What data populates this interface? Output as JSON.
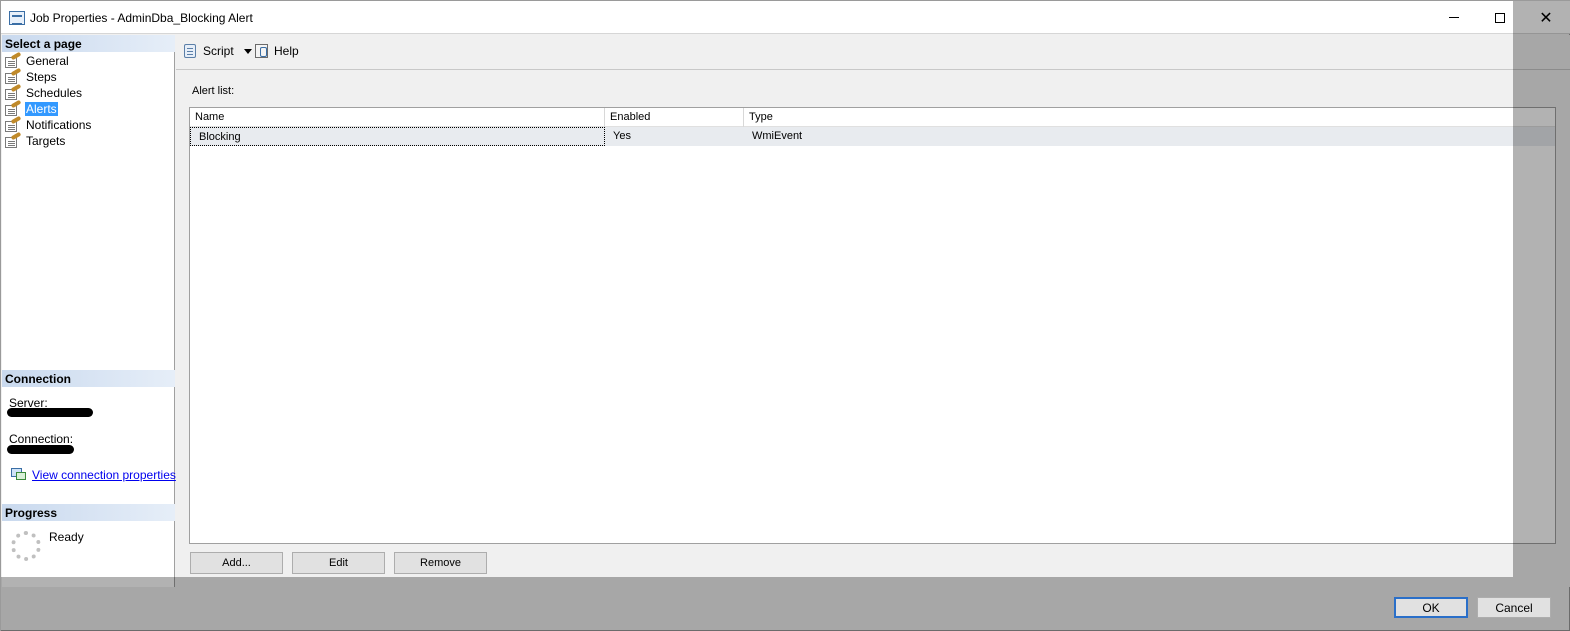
{
  "window": {
    "title": "Job Properties - AdminDba_Blocking Alert"
  },
  "left_pane": {
    "select_page_header": "Select a page",
    "pages": [
      {
        "label": "General"
      },
      {
        "label": "Steps"
      },
      {
        "label": "Schedules"
      },
      {
        "label": "Alerts",
        "selected": true
      },
      {
        "label": "Notifications"
      },
      {
        "label": "Targets"
      }
    ],
    "connection_header": "Connection",
    "server_label": "Server:",
    "connection_label": "Connection:",
    "view_connection_link": "View connection properties",
    "progress_header": "Progress",
    "progress_status": "Ready"
  },
  "toolbar": {
    "script_label": "Script",
    "help_label": "Help"
  },
  "main": {
    "alert_list_label": "Alert list:",
    "columns": [
      "Name",
      "Enabled",
      "Type"
    ],
    "rows": [
      {
        "name": "Blocking",
        "enabled": "Yes",
        "type": "WmiEvent"
      }
    ],
    "buttons": {
      "add": "Add...",
      "edit": "Edit",
      "remove": "Remove"
    }
  },
  "footer": {
    "ok": "OK",
    "cancel": "Cancel"
  },
  "colors": {
    "selection": "#3399ff",
    "header_gradient_start": "#c9d9ee",
    "row_background": "#e8ebef",
    "link": "#0000ee"
  }
}
